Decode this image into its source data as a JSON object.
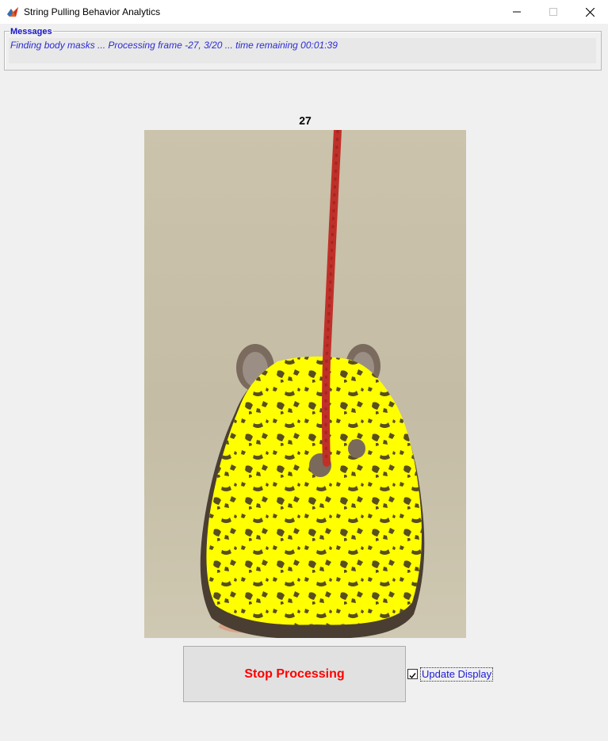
{
  "window": {
    "title": "String Pulling Behavior Analytics",
    "icon": "matlab-icon",
    "controls": [
      "minimize-icon",
      "maximize-icon",
      "close-icon"
    ]
  },
  "messages": {
    "legend": "Messages",
    "text": "Finding body masks ... Processing frame -27, 3/20 ... time remaining 00:01:39"
  },
  "display": {
    "frame_label": "27"
  },
  "controls": {
    "stop_label": "Stop Processing",
    "update_display_label": "Update Display",
    "update_display_checked": true
  },
  "colors": {
    "legend": "#1515c9",
    "message_text": "#2b2bd6",
    "stop_text": "#ff0000",
    "mask_yellow": "#ffff00",
    "string_red": "#c0302a"
  }
}
